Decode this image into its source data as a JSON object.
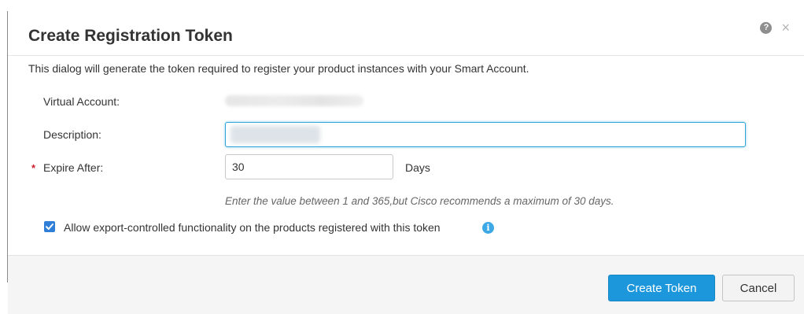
{
  "dialog": {
    "title": "Create Registration Token",
    "intro": "This dialog will generate the token required to register your product instances with your Smart Account."
  },
  "icons": {
    "help": "help-icon",
    "close": "close-icon",
    "info": "info-icon",
    "check": "check-icon"
  },
  "header": {
    "help_glyph": "?",
    "close_glyph": "×"
  },
  "form": {
    "virtual_account_label": "Virtual Account:",
    "description_label": "Description:",
    "description_value": "",
    "expire_label": "Expire After:",
    "required_marker": "*",
    "expire_value": "30",
    "expire_unit": "Days",
    "expire_hint": "Enter the value between 1 and 365,but Cisco recommends a maximum of 30 days.",
    "export_checkbox_checked": true,
    "export_checkbox_label": "Allow export-controlled functionality on the products registered with this token",
    "info_glyph": "i"
  },
  "footer": {
    "create_label": "Create Token",
    "cancel_label": "Cancel"
  },
  "colors": {
    "primary_button": "#1d97dc",
    "focus_border": "#2ba4d9",
    "required": "#cf2030",
    "checkbox": "#2f7fd8",
    "info": "#3da8e6"
  }
}
